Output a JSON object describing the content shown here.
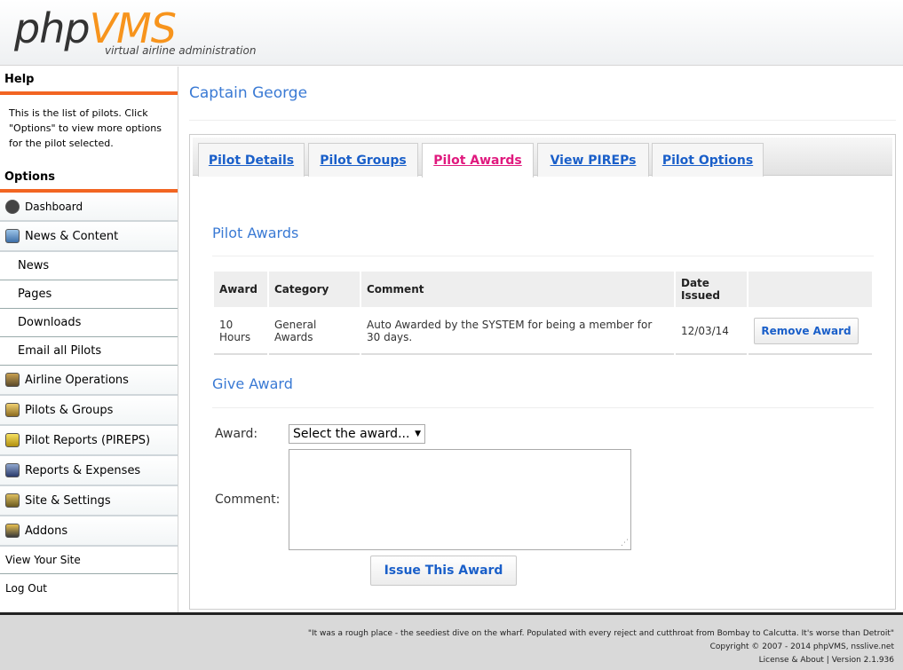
{
  "header": {
    "logo_php": "php",
    "logo_vms": "VMS",
    "tagline": "virtual airline administration"
  },
  "sidebar": {
    "help_title": "Help",
    "help_text": "This is the list of pilots. Click \"Options\" to view more options for the pilot selected.",
    "options_title": "Options",
    "items": [
      {
        "label": "Dashboard"
      },
      {
        "label": "News & Content"
      },
      {
        "label": "News"
      },
      {
        "label": "Pages"
      },
      {
        "label": "Downloads"
      },
      {
        "label": "Email all Pilots"
      },
      {
        "label": "Airline Operations"
      },
      {
        "label": "Pilots & Groups"
      },
      {
        "label": "Pilot Reports (PIREPS)"
      },
      {
        "label": "Reports & Expenses"
      },
      {
        "label": "Site & Settings"
      },
      {
        "label": "Addons"
      },
      {
        "label": "View Your Site"
      },
      {
        "label": "Log Out"
      }
    ]
  },
  "main": {
    "title": "Captain George",
    "tabs": [
      {
        "label": "Pilot Details"
      },
      {
        "label": "Pilot Groups"
      },
      {
        "label": "Pilot Awards",
        "active": true
      },
      {
        "label": "View PIREPs"
      },
      {
        "label": "Pilot Options"
      }
    ],
    "awards_title": "Pilot Awards",
    "table": {
      "headers": [
        "Award",
        "Category",
        "Comment",
        "Date Issued",
        ""
      ],
      "rows": [
        [
          "10 Hours",
          "General Awards",
          "Auto Awarded by the SYSTEM for being a member for 30 days.",
          "12/03/14"
        ]
      ],
      "remove_label": "Remove Award"
    },
    "give_title": "Give Award",
    "award_label": "Award:",
    "award_select": "Select the award...",
    "comment_label": "Comment:",
    "issue_label": "Issue This Award"
  },
  "footer": {
    "quote": "\"It was a rough place - the seediest dive on the wharf. Populated with every reject and cutthroat from Bombay to Calcutta. It's worse than Detroit\"",
    "copyright": "Copyright © 2007 - 2014 phpVMS, nsslive.net",
    "license": "License & About | Version 2.1.936"
  },
  "colors": {
    "accent": "#f26522",
    "link": "#1a5fc9",
    "active_tab": "#e0197e",
    "title": "#3a7ad4"
  }
}
